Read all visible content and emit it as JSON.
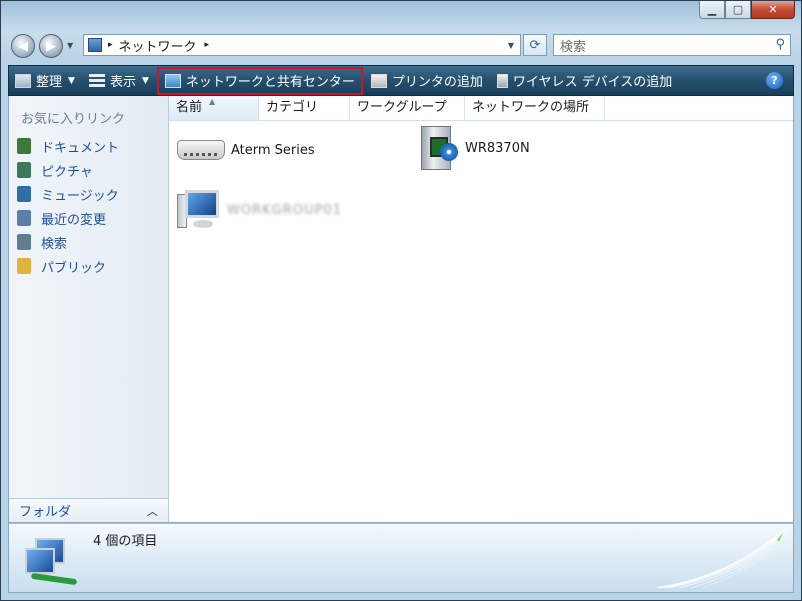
{
  "window": {
    "caption_buttons": [
      "minimize-icon",
      "maximize-icon",
      "close-icon"
    ]
  },
  "address_bar": {
    "location": "ネットワーク",
    "separator": "▸"
  },
  "search": {
    "placeholder": "検索"
  },
  "toolbar": {
    "organize": "整理",
    "view": "表示",
    "network_center": "ネットワークと共有センター",
    "add_printer": "プリンタの追加",
    "add_wireless": "ワイヤレス デバイスの追加",
    "help": "?"
  },
  "sidebar": {
    "header": "お気に入りリンク",
    "items": [
      {
        "label": "ドキュメント",
        "icon": "documents-icon",
        "color": "#3b7a3b"
      },
      {
        "label": "ピクチャ",
        "icon": "pictures-icon",
        "color": "#3b7a5c"
      },
      {
        "label": "ミュージック",
        "icon": "music-icon",
        "color": "#2d6fa8"
      },
      {
        "label": "最近の変更",
        "icon": "recent-changes-icon",
        "color": "#5b7fa8"
      },
      {
        "label": "検索",
        "icon": "search-folder-icon",
        "color": "#5e7f93"
      },
      {
        "label": "パブリック",
        "icon": "public-folder-icon",
        "color": "#e0b43a"
      }
    ],
    "folders": "フォルダ"
  },
  "columns": [
    "名前",
    "カテゴリ",
    "ワークグループ",
    "ネットワークの場所"
  ],
  "items": [
    {
      "label": "Aterm Series",
      "icon": "router-icon"
    },
    {
      "label": "WR8370N",
      "icon": "media-device-icon"
    },
    {
      "label": "WORKGROUP01",
      "icon": "computer-icon"
    }
  ],
  "details": {
    "count_text": "4 個の項目"
  }
}
